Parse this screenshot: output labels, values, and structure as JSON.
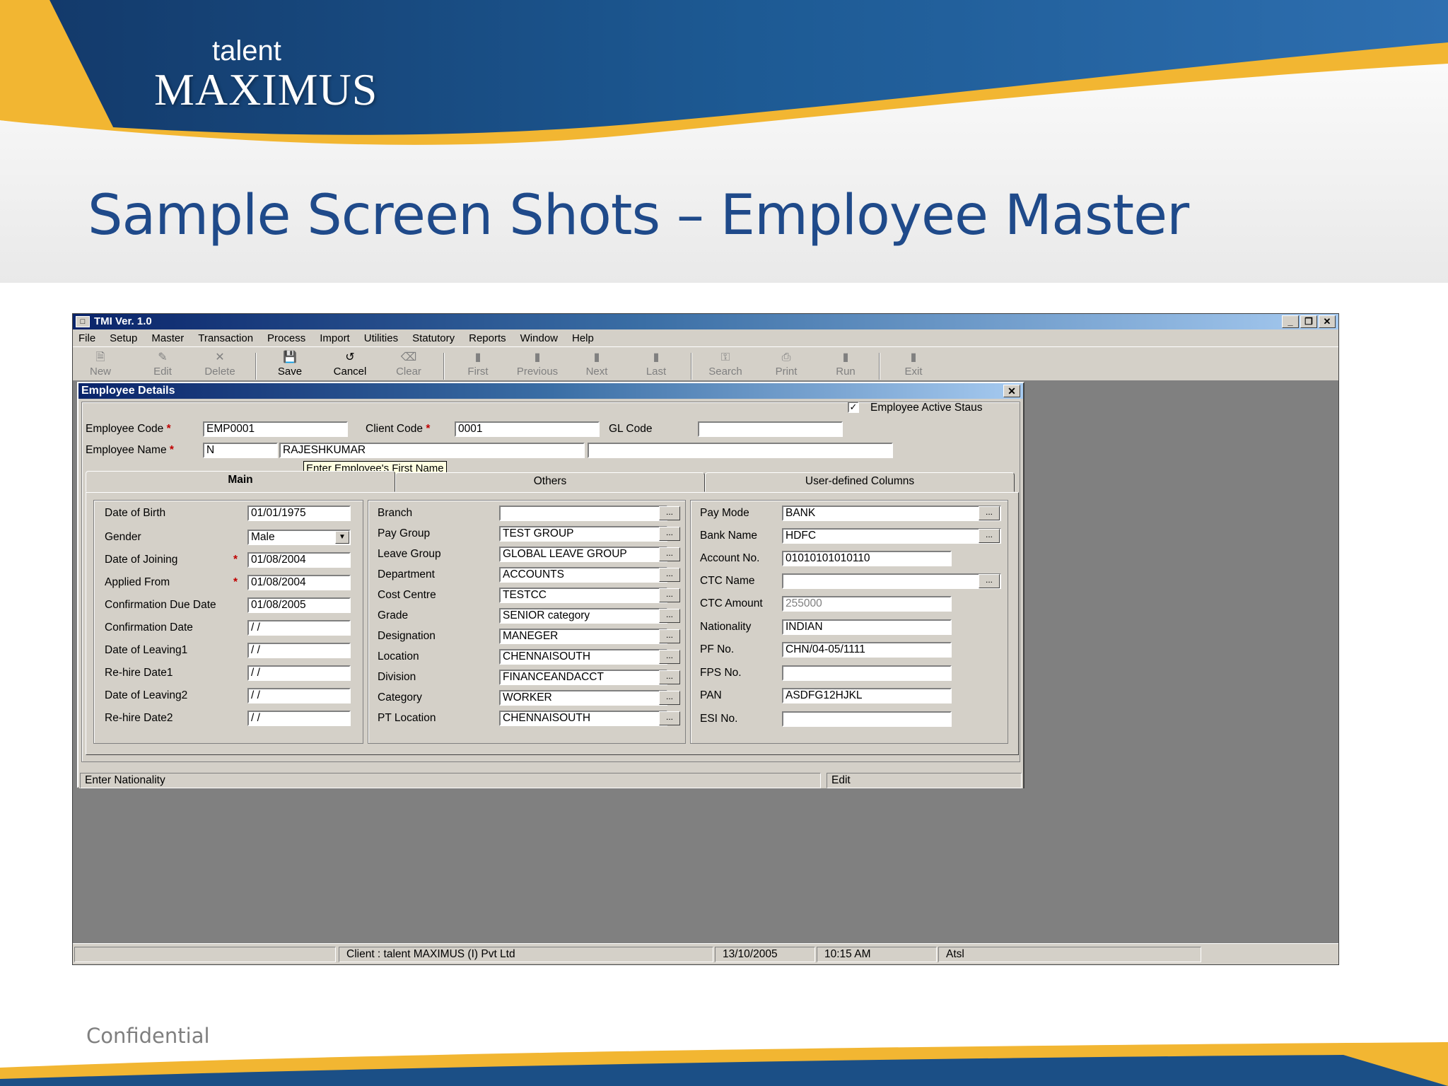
{
  "slide": {
    "logo_small": "talent",
    "logo_main": "MAXIMUS",
    "title": "Sample Screen Shots – Employee Master",
    "footer": "Confidential"
  },
  "colors": {
    "title": "#1f4a8a",
    "banner_blue": "#1b4f86",
    "banner_gold": "#f2b632",
    "required": "#c00000"
  },
  "app": {
    "title": "TMI Ver. 1.0",
    "menu": [
      "File",
      "Setup",
      "Master",
      "Transaction",
      "Process",
      "Import",
      "Utilities",
      "Statutory",
      "Reports",
      "Window",
      "Help"
    ],
    "toolbar": [
      {
        "label": "New",
        "icon": "new-doc-icon"
      },
      {
        "label": "Edit",
        "icon": "edit-icon"
      },
      {
        "label": "Delete",
        "icon": "delete-x-icon"
      },
      {
        "label": "Save",
        "icon": "floppy-icon"
      },
      {
        "label": "Cancel",
        "icon": "cancel-icon"
      },
      {
        "label": "Clear",
        "icon": "eraser-icon"
      },
      {
        "label": "First",
        "icon": "first-icon"
      },
      {
        "label": "Previous",
        "icon": "previous-icon"
      },
      {
        "label": "Next",
        "icon": "next-icon"
      },
      {
        "label": "Last",
        "icon": "last-icon"
      },
      {
        "label": "Search",
        "icon": "binoculars-icon"
      },
      {
        "label": "Print",
        "icon": "printer-icon"
      },
      {
        "label": "Run",
        "icon": "run-icon"
      },
      {
        "label": "Exit",
        "icon": "exit-icon"
      }
    ]
  },
  "form": {
    "window_title": "Employee Details",
    "active_status_label": "Employee Active Staus",
    "active_status_checked": true,
    "employee_code_label": "Employee Code",
    "employee_code": "EMP0001",
    "client_code_label": "Client Code",
    "client_code": "0001",
    "gl_code_label": "GL Code",
    "gl_code": "",
    "employee_name_label": "Employee Name",
    "name_title": "N",
    "first_name": "RAJESHKUMAR",
    "last_name": "",
    "required_mark": "*",
    "tooltip": "Enter Employee's First Name",
    "tabs": [
      "Main",
      "Others",
      "User-defined Columns"
    ],
    "left_fields": [
      {
        "label": "Date of Birth",
        "value": "01/01/1975",
        "required": false
      },
      {
        "label": "Gender",
        "value": "Male",
        "required": false
      },
      {
        "label": "Date of Joining",
        "value": "01/08/2004",
        "required": true
      },
      {
        "label": "Applied From",
        "value": "01/08/2004",
        "required": true
      },
      {
        "label": "Confirmation Due Date",
        "value": "01/08/2005",
        "required": false
      },
      {
        "label": "Confirmation Date",
        "value": "/ /",
        "required": false
      },
      {
        "label": "Date of Leaving1",
        "value": "/ /",
        "required": false
      },
      {
        "label": "Re-hire Date1",
        "value": "/ /",
        "required": false
      },
      {
        "label": "Date of Leaving2",
        "value": "/ /",
        "required": false
      },
      {
        "label": "Re-hire Date2",
        "value": "/ /",
        "required": false
      }
    ],
    "mid_fields": [
      {
        "label": "Branch",
        "value": ""
      },
      {
        "label": "Pay Group",
        "value": "TEST GROUP"
      },
      {
        "label": "Leave Group",
        "value": "GLOBAL LEAVE GROUP"
      },
      {
        "label": "Department",
        "value": "ACCOUNTS"
      },
      {
        "label": "Cost Centre",
        "value": "TESTCC"
      },
      {
        "label": "Grade",
        "value": "SENIOR category"
      },
      {
        "label": "Designation",
        "value": "MANEGER"
      },
      {
        "label": "Location",
        "value": "CHENNAISOUTH"
      },
      {
        "label": "Division",
        "value": "FINANCEANDACCT"
      },
      {
        "label": "Category",
        "value": "WORKER"
      },
      {
        "label": "PT Location",
        "value": "CHENNAISOUTH"
      }
    ],
    "right_fields": [
      {
        "label": "Pay Mode",
        "value": "BANK"
      },
      {
        "label": "Bank Name",
        "value": "HDFC"
      },
      {
        "label": "Account No.",
        "value": "01010101010110"
      },
      {
        "label": "CTC Name",
        "value": ""
      },
      {
        "label": "CTC Amount",
        "value": "255000"
      },
      {
        "label": "Nationality",
        "value": "INDIAN"
      },
      {
        "label": "PF No.",
        "value": "CHN/04-05/1111"
      },
      {
        "label": "FPS No.",
        "value": ""
      },
      {
        "label": "PAN",
        "value": "ASDFG12HJKL"
      },
      {
        "label": "ESI No.",
        "value": ""
      }
    ],
    "ellipsis": "...",
    "status_hint": "Enter Nationality",
    "status_mode": "Edit"
  },
  "statusbar": {
    "client": "Client :  talent MAXIMUS (I) Pvt Ltd",
    "date": "13/10/2005",
    "time": "10:15 AM",
    "user": "Atsl"
  }
}
